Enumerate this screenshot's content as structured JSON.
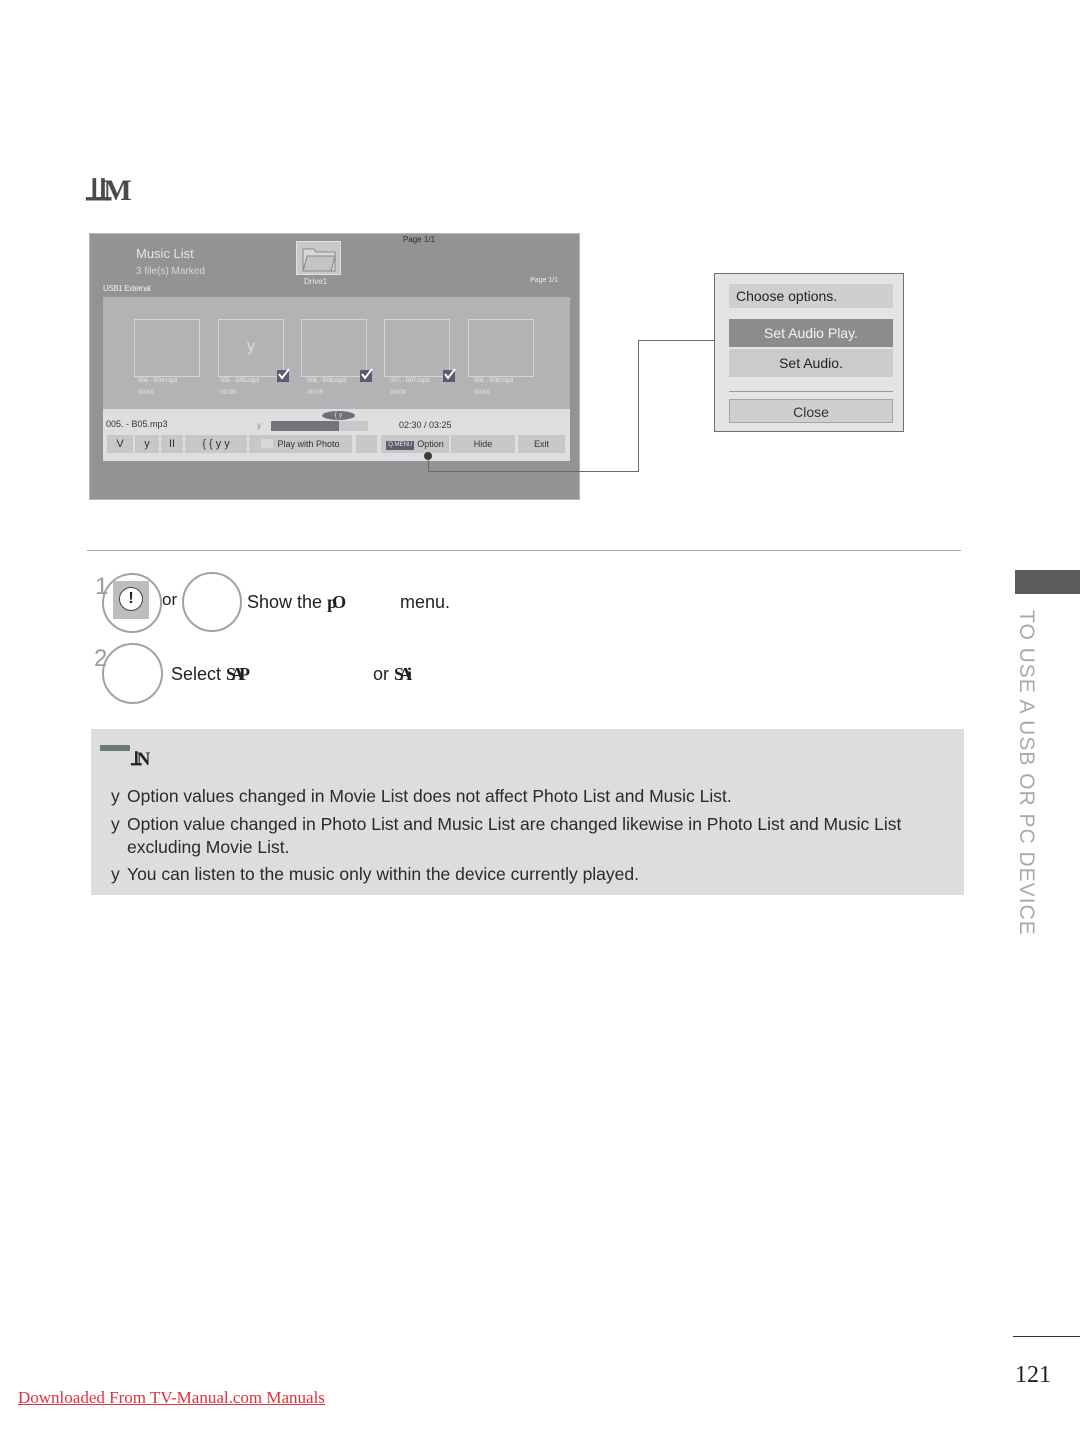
{
  "section_heading": "ꞱꞱM",
  "tv": {
    "title": "Music List",
    "marked": "3 file(s) Marked",
    "source": "USB1 External",
    "drive": "Drive1",
    "page_top": "Page 1/1",
    "page_right": "Page 1/1",
    "tracks": [
      {
        "name": "004. - B04.mp3",
        "time": "00:00",
        "checked": false,
        "glyph": ""
      },
      {
        "name": "005. - B05.mp3",
        "time": "00:00",
        "checked": true,
        "glyph": "y"
      },
      {
        "name": "006. - B06.mp3",
        "time": "00:00",
        "checked": true,
        "glyph": ""
      },
      {
        "name": "007. - B07.mp3",
        "time": "00:00",
        "checked": true,
        "glyph": ""
      },
      {
        "name": "008. - B08.mp3",
        "time": "00:00",
        "checked": false,
        "glyph": ""
      }
    ],
    "player": {
      "now_playing": "005. - B05.mp3",
      "progress_glyph": "y",
      "progress_fraction": 0.7,
      "pill_label": "{ y",
      "time": "02:30 / 03:25",
      "controls": [
        "V",
        "y",
        "II",
        "{ {  y y"
      ],
      "play_with_photo": "Play with Photo",
      "qmenu_badge": "Q.MENU",
      "option": "Option",
      "hide": "Hide",
      "exit": "Exit"
    }
  },
  "popup": {
    "title": "Choose options.",
    "items": [
      "Set Audio Play.",
      "Set Audio."
    ],
    "close": "Close"
  },
  "steps": [
    {
      "number": "1",
      "button_glyph": "!",
      "or": "or",
      "text_a": "Show the ",
      "text_garb": "pO",
      "text_b": "menu."
    },
    {
      "number": "2",
      "text_a": "Select ",
      "text_garb": "SAP",
      "text_or": "or ",
      "text_garb2": "SAi"
    }
  ],
  "note": {
    "heading": "ꞱN",
    "bullet": "y",
    "lines": [
      "Option values changed in Movie List does not affect Photo List and Music List.",
      "Option value changed in Photo List and Music List are changed likewise in Photo List and Music List",
      "excluding Movie List.",
      "You can listen to the music only within the device currently played."
    ]
  },
  "side_tab_text": "TO USE A USB OR PC DEVICE",
  "page_number": "121",
  "footer_link": "Downloaded From TV-Manual.com Manuals"
}
